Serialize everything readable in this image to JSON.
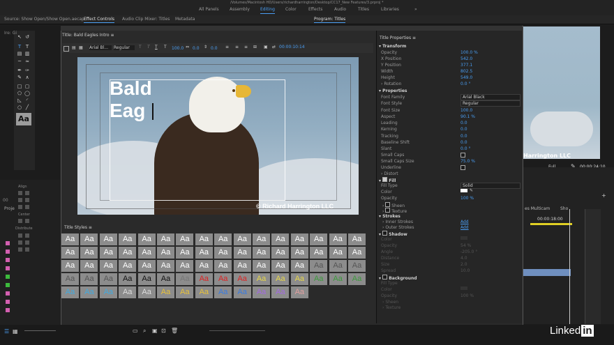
{
  "app": {
    "path_title": "/Volumes/Macintosh HD/Users/richardharrington/Desktop/CC17_New Features/3.prproj *",
    "workspaces": [
      "All Panels",
      "Assembly",
      "Editing",
      "Color",
      "Effects",
      "Audio",
      "Titles",
      "Libraries"
    ],
    "active_workspace": "Editing",
    "more": "»"
  },
  "source_tabs": {
    "source": "Source: Show Open/Show Open.aecap",
    "effect_controls": "Effect Controls",
    "audio_clip_mixer": "Audio Clip Mixer: Titles",
    "metadata": "Metadata",
    "program": "Program: Titles"
  },
  "left_panel": {
    "align": "Align",
    "center": "Center",
    "distribute": "Distribute",
    "project_tab": "Proje",
    "clip_label": "Ire: Gi",
    "timecode": "00"
  },
  "titler": {
    "title_tab": "Title: Bald Eagles Intro",
    "font": "Arial Bl...",
    "style": "Regular",
    "size": "100.0",
    "kerning": "0.0",
    "leading": "0.0",
    "timecode": "00:00:10:14",
    "title_text_line1": "Bald",
    "title_text_line2": "Eag",
    "copyright": "© Richard Harrington LLC",
    "styles_label": "Title Styles",
    "style_swatch_text": "Aa",
    "style_rows": [
      [
        "#8c8c8c",
        "#8c8c8c",
        "#8c8c8c",
        "#8c8c8c",
        "#8c8c8c",
        "#8c8c8c",
        "#8c8c8c",
        "#8c8c8c",
        "#8c8c8c",
        "#8c8c8c",
        "#8c8c8c",
        "#8c8c8c",
        "#8c8c8c",
        "#8c8c8c",
        "#8c8c8c",
        "#8c8c8c"
      ],
      [
        "#8c8c8c",
        "#8c8c8c",
        "#8c8c8c",
        "#8c8c8c",
        "#8c8c8c",
        "#8c8c8c",
        "#8c8c8c",
        "#8c8c8c",
        "#8c8c8c",
        "#8c8c8c",
        "#8c8c8c",
        "#8c8c8c",
        "#8c8c8c",
        "#8c8c8c",
        "#8c8c8c",
        "#8c8c8c"
      ],
      [
        "#8c8c8c",
        "#8c8c8c",
        "#8c8c8c",
        "#8c8c8c",
        "#8c8c8c",
        "#8c8c8c",
        "#8c8c8c",
        "#8c8c8c",
        "#8c8c8c",
        "#8c8c8c",
        "#8c8c8c",
        "#8c8c8c",
        "#8c8c8c",
        "#8c8c8c",
        "#8c8c8c",
        "#8c8c8c"
      ],
      [
        "#8c8c8c",
        "#8c8c8c",
        "#8c8c8c",
        "#8c8c8c",
        "#8c8c8c",
        "#8c8c8c",
        "#8c8c8c",
        "#8c8c8c",
        "#8c8c8c",
        "#8c8c8c",
        "#8c8c8c",
        "#8c8c8c",
        "#8c8c8c",
        "#8c8c8c",
        "#8c8c8c",
        "#8c8c8c"
      ],
      [
        "#8c8c8c",
        "#8c8c8c",
        "#8c8c8c",
        "#8c8c8c",
        "#8c8c8c",
        "#8c8c8c",
        "#8c8c8c",
        "#8c8c8c",
        "#8c8c8c",
        "#8c8c8c",
        "#8c8c8c",
        "#8c8c8c",
        "#8c8c8c"
      ]
    ],
    "style_text_colors": [
      [
        "#fff",
        "#fff",
        "#fff",
        "#fff",
        "#fff",
        "#fff",
        "#fff",
        "#fff",
        "#fff",
        "#fff",
        "#fff",
        "#fff",
        "#fff",
        "#fff",
        "#fff",
        "#fff"
      ],
      [
        "#fff",
        "#fff",
        "#fff",
        "#fff",
        "#fff",
        "#fff",
        "#fff",
        "#fff",
        "#fff",
        "#fff",
        "#fff",
        "#fff",
        "#fff",
        "#fff",
        "#fff",
        "#fff"
      ],
      [
        "#fff",
        "#fff",
        "#fff",
        "#fff",
        "#fff",
        "#fff",
        "#fff",
        "#fff",
        "#fff",
        "#fff",
        "#fff",
        "#fff",
        "#fff",
        "#555",
        "#555",
        "#555"
      ],
      [
        "#555",
        "#555",
        "#555",
        "#111",
        "#111",
        "#111",
        "#777",
        "#d22",
        "#d22",
        "#d22",
        "#e8d84a",
        "#e8d84a",
        "#e8d84a",
        "#3b9a3b",
        "#3b9a3b",
        "#3b9a3b"
      ],
      [
        "#4ad",
        "#4ad",
        "#4ad",
        "#ddd",
        "#ddd",
        "#e8c23a",
        "#e8c23a",
        "#e8c23a",
        "#3a7be0",
        "#3a7be0",
        "#a36be0",
        "#a36be0",
        "#e0a0a0"
      ]
    ]
  },
  "properties": {
    "header": "Title Properties",
    "menu": "≡",
    "transform": {
      "label": "Transform",
      "rows": [
        {
          "label": "Opacity",
          "value": "100.0 %"
        },
        {
          "label": "X Position",
          "value": "542.0"
        },
        {
          "label": "Y Position",
          "value": "377.1"
        },
        {
          "label": "Width",
          "value": "802.5"
        },
        {
          "label": "Height",
          "value": "549.0"
        },
        {
          "label": "Rotation",
          "value": "0.0 °"
        }
      ]
    },
    "props": {
      "label": "Properties",
      "font_family_label": "Font Family",
      "font_family_value": "Arial Black",
      "font_style_label": "Font Style",
      "font_style_value": "Regular",
      "rows": [
        {
          "label": "Font Size",
          "value": "100.0"
        },
        {
          "label": "Aspect",
          "value": "90.1 %"
        },
        {
          "label": "Leading",
          "value": "0.0"
        },
        {
          "label": "Kerning",
          "value": "0.0"
        },
        {
          "label": "Tracking",
          "value": "0.0"
        },
        {
          "label": "Baseline Shift",
          "value": "0.0"
        },
        {
          "label": "Slant",
          "value": "0.0 °"
        }
      ],
      "small_caps": "Small Caps",
      "small_caps_size_label": "Small Caps Size",
      "small_caps_size_value": "75.0 %",
      "underline": "Underline",
      "distort": "Distort"
    },
    "fill": {
      "label": "Fill",
      "fill_type_label": "Fill Type",
      "fill_type_value": "Solid",
      "color_label": "Color",
      "opacity_label": "Opacity",
      "opacity_value": "100 %",
      "sheen": "Sheen",
      "texture": "Texture"
    },
    "strokes": {
      "label": "Strokes",
      "inner": "Inner Strokes",
      "outer": "Outer Strokes",
      "add": "Add"
    },
    "shadow": {
      "label": "Shadow",
      "rows": [
        "Color",
        "Opacity",
        "Angle",
        "Distance",
        "Size",
        "Spread"
      ],
      "values": [
        "",
        "54 %",
        "-205.0 °",
        "4.0",
        "2.0",
        "10.0"
      ]
    },
    "background": {
      "label": "Background",
      "rows": [
        "Fill Type",
        "Color",
        "Opacity"
      ],
      "values": [
        "",
        "",
        "100 %"
      ],
      "sheen": "Sheen",
      "texture": "Texture"
    }
  },
  "program_monitor": {
    "overlay_text": "Harrington LLC",
    "fit": "Full",
    "timecode": "00:00:24:10"
  },
  "timeline": {
    "tab1": "es Multicam",
    "tab2": "Sho",
    "ruler_time": "00:00:18:00"
  },
  "watermark": {
    "text": "Linked",
    "box": "in"
  }
}
